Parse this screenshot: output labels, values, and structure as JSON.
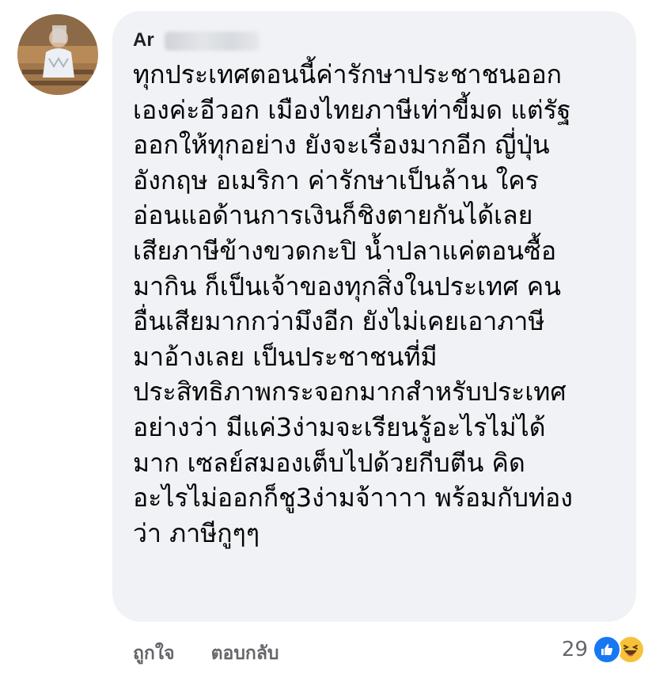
{
  "comment": {
    "author": "Ar",
    "lines": [
      "ทุกประเทศตอนนี้ค่ารักษาประชาชนออก",
      "เองค่ะอีวอก เมืองไทยภาษีเท่าขี้มด แต่รัฐ",
      "ออกให้ทุกอย่าง ยังจะเรื่องมากอีก ญี่ปุ่น",
      "อังกฤษ อเมริกา ค่ารักษาเป็นล้าน ใคร",
      "อ่อนแอด้านการเงินก็ชิงตายกันได้เลย",
      "เสียภาษีข้างขวดกะปิ น้ำปลาแค่ตอนซื้อ",
      "มากิน  ก็เป็นเจ้าของทุกสิ่งในประเทศ คน",
      "อื่นเสียมากกว่ามึงอีก ยังไม่เคยเอาภาษี",
      "มาอ้างเลย เป็นประชาชนที่มี",
      "ประสิทธิภาพกระจอกมากสำหรับประเทศ",
      "อย่างว่า มีแค่3ง่ามจะเรียนรู้อะไรไม่ได้",
      "มาก เซลย์สมองเต็บไปด้วยกีบตีน คิด",
      "อะไรไม่ออกก็ชู3ง่ามจ้าาาา พร้อมกับท่อง",
      "ว่า ภาษีกูๆๆ"
    ]
  },
  "actions": {
    "like_label": "ถูกใจ",
    "reply_label": "ตอบกลับ"
  },
  "reactions": {
    "count": "29",
    "icons": [
      "like-icon",
      "haha-icon"
    ]
  },
  "colors": {
    "bubble": "#f0f2f5",
    "text": "#050505",
    "action_text": "#65676b",
    "like_blue": "#1877f2",
    "haha_yellow": "#f7c23a"
  }
}
